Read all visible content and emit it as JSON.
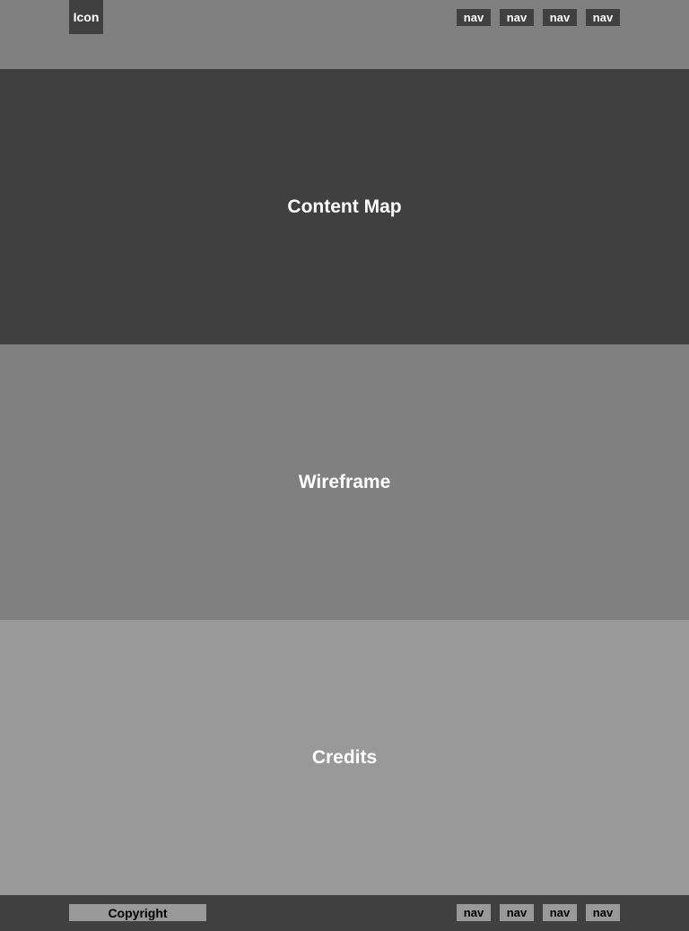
{
  "header": {
    "icon_label": "Icon",
    "nav": [
      "nav",
      "nav",
      "nav",
      "nav"
    ]
  },
  "sections": [
    "Content Map",
    "Wireframe",
    "Credits"
  ],
  "footer": {
    "copyright": "Copyright",
    "nav": [
      "nav",
      "nav",
      "nav",
      "nav"
    ]
  }
}
